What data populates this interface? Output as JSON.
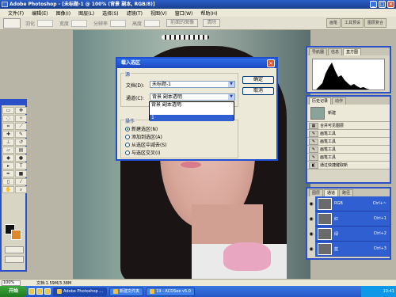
{
  "window": {
    "title": "Adobe Photoshop - [未标题-1 @ 100% (背景 副本, RGB/8)]",
    "controls": {
      "minimize": "_",
      "maximize": "□",
      "close": "×"
    }
  },
  "menu": {
    "items": [
      "文件(F)",
      "编辑(E)",
      "图像(I)",
      "图层(L)",
      "选择(S)",
      "滤镜(T)",
      "视图(V)",
      "窗口(W)",
      "帮助(H)"
    ]
  },
  "options": {
    "feather_label": "羽化",
    "width_label": "宽度",
    "resolution_label": "分辨率",
    "height_label": "高度",
    "front_image_button": "前面的图像",
    "clear_button": "清除",
    "tabs": [
      "画笔",
      "工具预设",
      "图层复合"
    ]
  },
  "dialog": {
    "title": "载入选区",
    "source_group": "源",
    "document_label": "文档(D):",
    "document_value": "未标题-1",
    "channel_label": "通道(C):",
    "channel_value": "背景 副本透明",
    "channel_options": [
      "背景 副本透明",
      "",
      "1"
    ],
    "operation_group": "操作",
    "operations": [
      {
        "label": "新建选区(N)",
        "selected": true
      },
      {
        "label": "添加到选区(A)",
        "selected": false
      },
      {
        "label": "从选区中减去(S)",
        "selected": false
      },
      {
        "label": "与选区交叉(I)",
        "selected": false
      }
    ],
    "ok_label": "确定",
    "cancel_label": "取消"
  },
  "panels": {
    "navigator_tabs": [
      "导航器",
      "信息",
      "直方图"
    ],
    "history_tabs": [
      "历史记录",
      "动作"
    ],
    "history_snapshot": "新建",
    "history_items": [
      "合并可见图层",
      "画笔工具",
      "画笔工具",
      "画笔工具",
      "画笔工具",
      "通过快捷键取新"
    ],
    "channel_tabs": [
      "图层",
      "通道",
      "路径"
    ],
    "channels": [
      {
        "name": "RGB",
        "shortcut": "Ctrl+~"
      },
      {
        "name": "红",
        "shortcut": "Ctrl+1"
      },
      {
        "name": "绿",
        "shortcut": "Ctrl+2"
      },
      {
        "name": "蓝",
        "shortcut": "Ctrl+3"
      }
    ]
  },
  "status": {
    "zoom": "100%",
    "doc_size": "文档:1.59M/3.38M"
  },
  "taskbar": {
    "start_label": "开始",
    "tasks": [
      "Adobe Photoshop ...",
      "新建文件夹",
      "19 - ACDSee v5.0"
    ],
    "tray_text": "10:41"
  }
}
